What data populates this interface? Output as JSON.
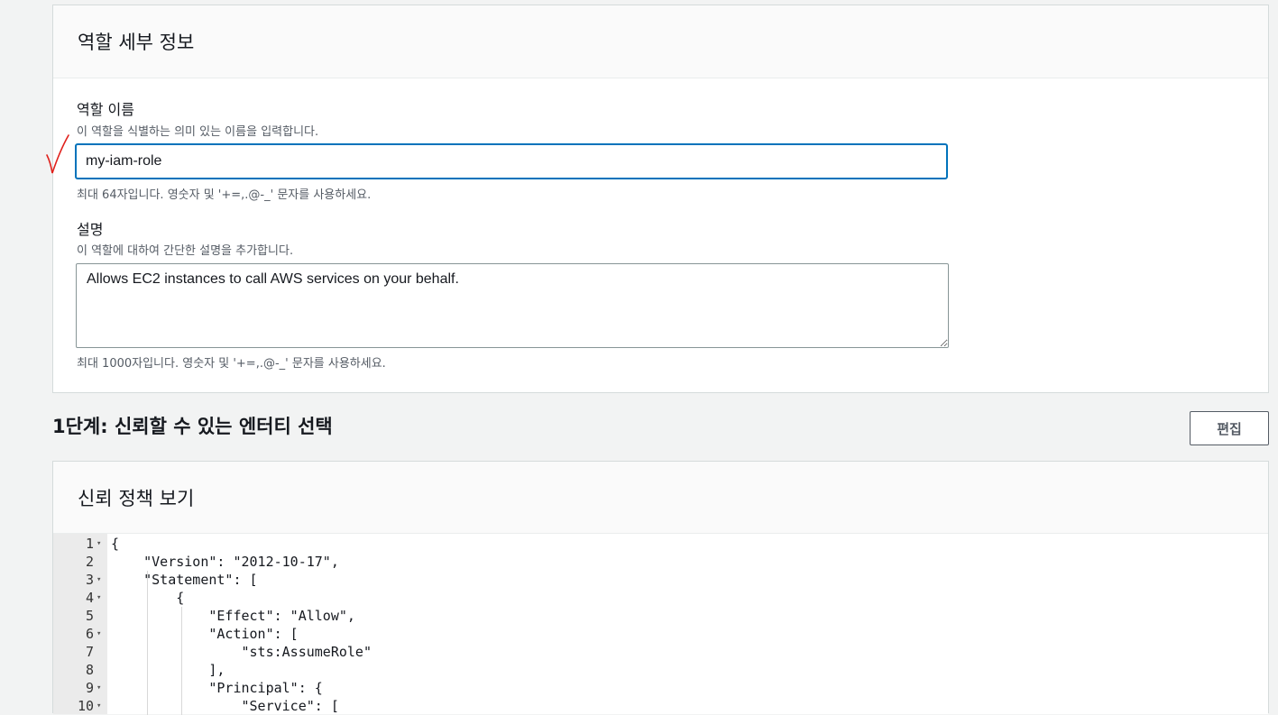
{
  "role_details": {
    "heading": "역할 세부 정보",
    "name_label": "역할 이름",
    "name_desc": "이 역할을 식별하는 의미 있는 이름을 입력합니다.",
    "name_value": "my-iam-role",
    "name_hint": "최대 64자입니다. 영숫자 및 '+=,.@-_' 문자를 사용하세요.",
    "desc_label": "설명",
    "desc_desc": "이 역할에 대하여 간단한 설명을 추가합니다.",
    "desc_value": "Allows EC2 instances to call AWS services on your behalf.",
    "desc_hint": "최대 1000자입니다. 영숫자 및 '+=,.@-_' 문자를 사용하세요."
  },
  "step1": {
    "title": "1단계: 신뢰할 수 있는 엔터티 선택",
    "edit_label": "편집"
  },
  "trust_policy": {
    "heading": "신뢰 정책 보기",
    "lines": [
      {
        "num": "1",
        "fold": true,
        "text": "{"
      },
      {
        "num": "2",
        "fold": false,
        "text": "    \"Version\": \"2012-10-17\","
      },
      {
        "num": "3",
        "fold": true,
        "text": "    \"Statement\": ["
      },
      {
        "num": "4",
        "fold": true,
        "text": "        {"
      },
      {
        "num": "5",
        "fold": false,
        "text": "            \"Effect\": \"Allow\","
      },
      {
        "num": "6",
        "fold": true,
        "text": "            \"Action\": ["
      },
      {
        "num": "7",
        "fold": false,
        "text": "                \"sts:AssumeRole\""
      },
      {
        "num": "8",
        "fold": false,
        "text": "            ],"
      },
      {
        "num": "9",
        "fold": true,
        "text": "            \"Principal\": {"
      },
      {
        "num": "10",
        "fold": true,
        "text": "                \"Service\": ["
      }
    ]
  },
  "colors": {
    "focus_border": "#0073bb",
    "annotation_mark": "#e0201b"
  }
}
